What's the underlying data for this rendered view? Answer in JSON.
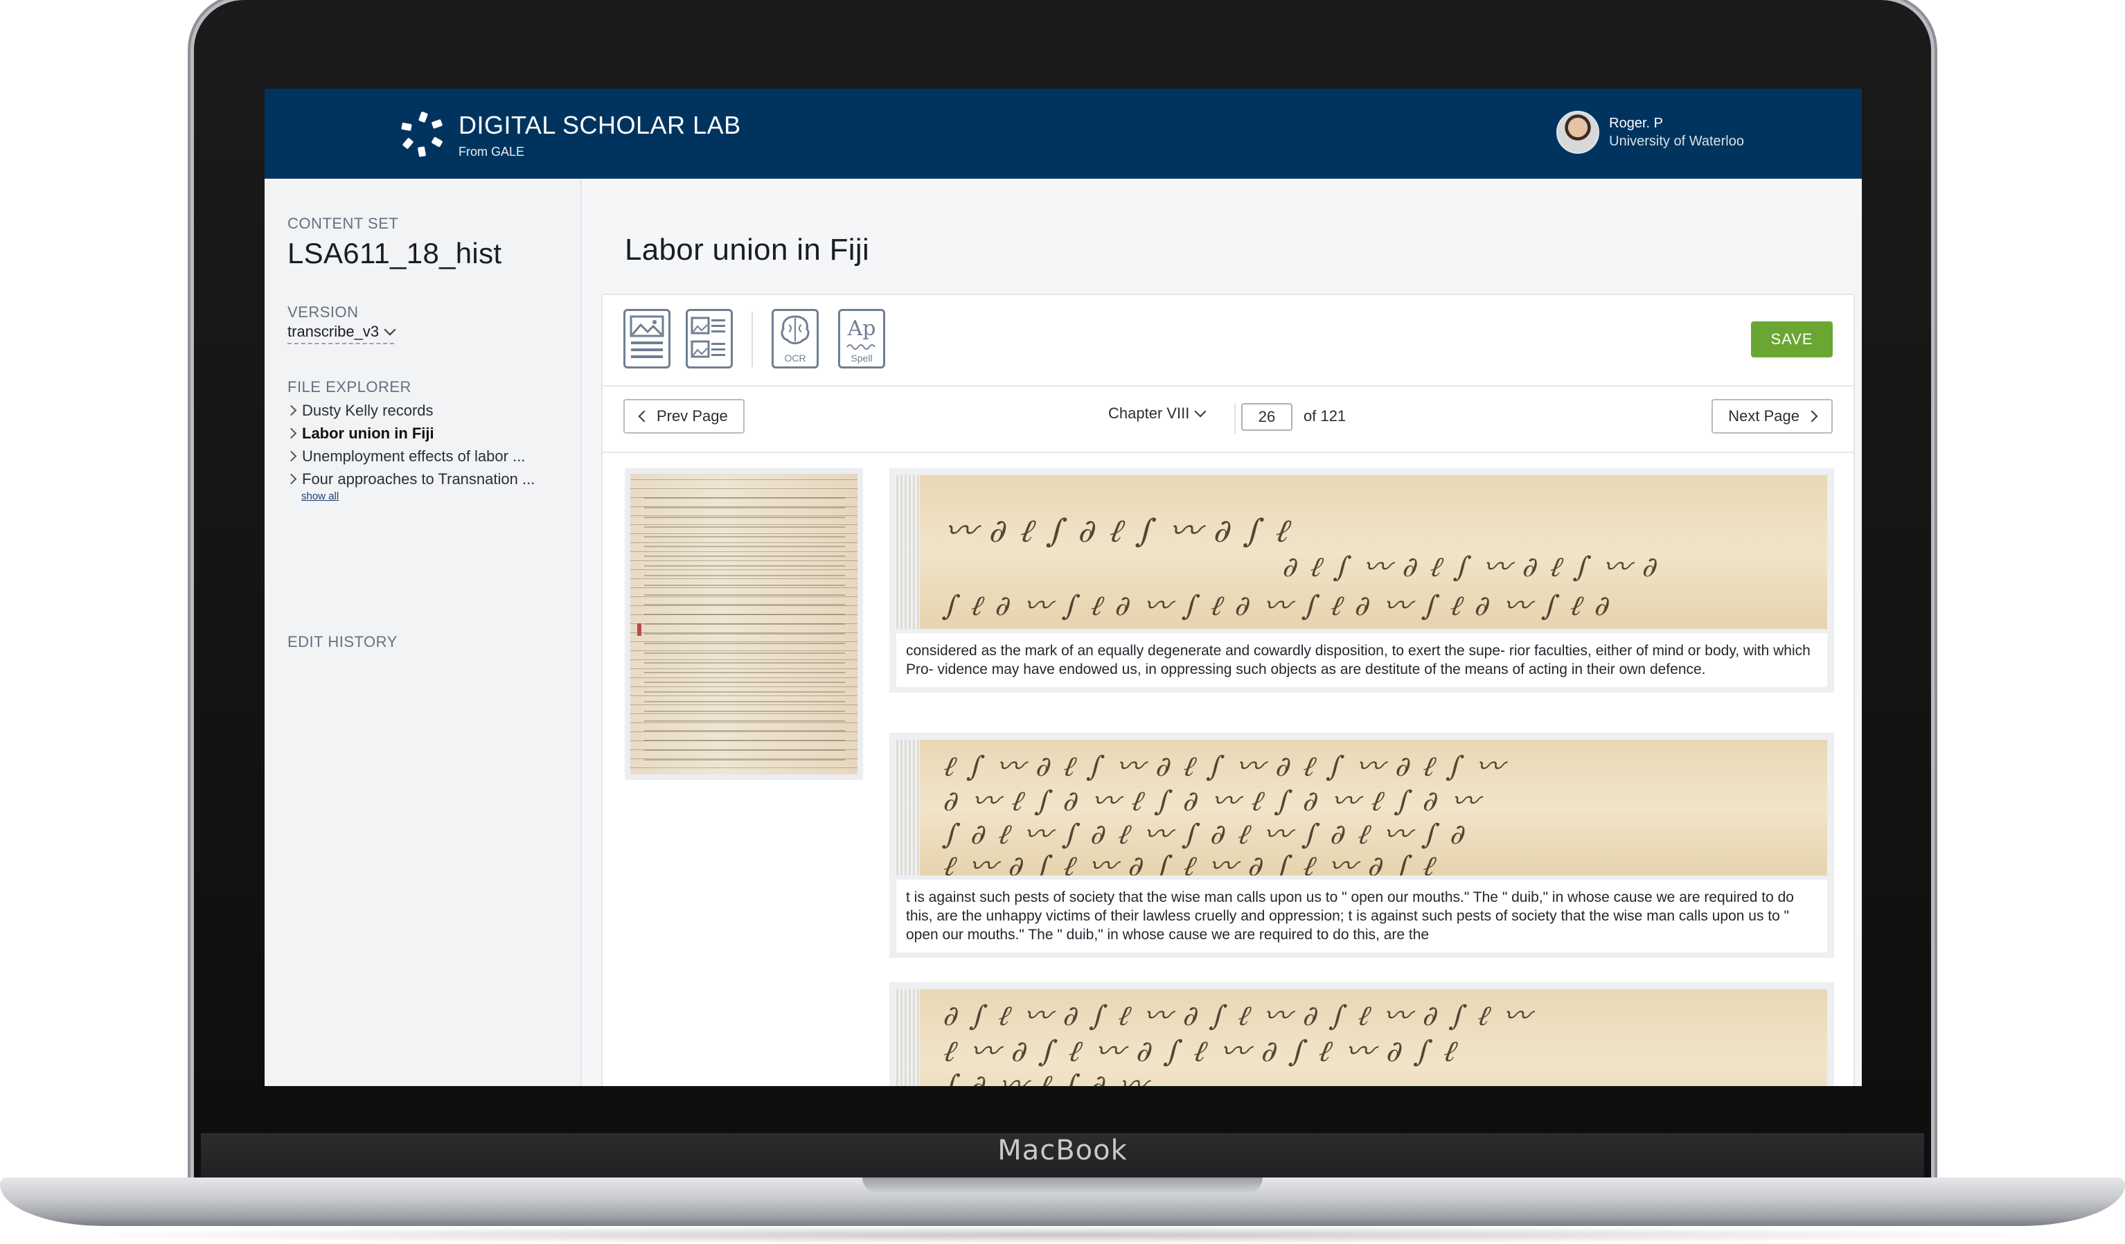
{
  "device": {
    "brand_label": "MacBook"
  },
  "header": {
    "app_title": "DIGITAL SCHOLAR LAB",
    "app_subtitle": "From GALE",
    "user_name": "Roger. P",
    "user_org": "University of Waterloo"
  },
  "sidebar": {
    "content_set_label": "CONTENT SET",
    "content_set_name": "LSA611_18_hist",
    "version_label": "VERSION",
    "version_value": "transcribe_v3",
    "file_explorer_label": "FILE EXPLORER",
    "files": [
      {
        "name": "Dusty Kelly records"
      },
      {
        "name": "Labor union in Fiji"
      },
      {
        "name": "Unemployment effects of labor ..."
      },
      {
        "name": "Four approaches to Transnation ..."
      }
    ],
    "show_all_label": "show all",
    "edit_history_label": "EDIT HISTORY"
  },
  "main": {
    "title": "Labor union in Fiji",
    "toolbar": {
      "tools": [
        {
          "icon": "image-document-icon"
        },
        {
          "icon": "image-list-icon"
        },
        {
          "icon": "ocr-brain-icon",
          "label": "OCR"
        },
        {
          "icon": "spell-check-icon",
          "glyph": "Ap",
          "label": "Spell"
        }
      ],
      "save_label": "SAVE",
      "save_color": "#6aa632"
    },
    "navigation": {
      "prev_label": "Prev Page",
      "next_label": "Next Page",
      "chapter": "Chapter VIII",
      "page_value": "26",
      "page_total": "of 121"
    },
    "snippets": [
      {
        "text": "considered as the mark of an equally degenerate and cowardly disposition, to exert the supe- rior faculties, either of mind or body, with which Pro- vidence may have endowed us, in oppressing such objects as are destitute of the means of acting in their own defence."
      },
      {
        "text": "t is against such pests of society that the wise man calls upon us to \" open our mouths.\" The \" duib,\" in whose cause we are required to do this, are the unhappy victims of their lawless cruelly and oppression; t is against such pests of society that the wise man calls upon us to \" open our mouths.\" The \" duib,\" in whose cause we are required to do this, are the"
      },
      {
        "text": ""
      }
    ]
  },
  "colors": {
    "header_bg": "#00345f",
    "accent_green": "#6aa632"
  }
}
